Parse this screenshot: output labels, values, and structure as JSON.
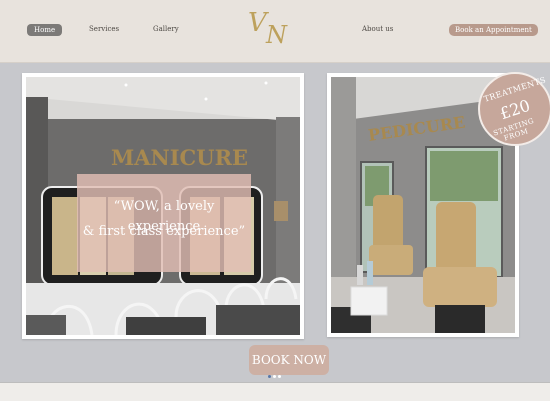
{
  "header": {
    "nav": {
      "home": "Home",
      "services": "Services",
      "gallery": "Gallery",
      "about": "About us",
      "book_appointment": "Book an Appointment"
    },
    "logo_text": {
      "v": "V",
      "n": "N"
    },
    "colors": {
      "background": "#e8e3dd",
      "logo": "#bda15c",
      "book_button": "#b89a8c"
    }
  },
  "gallery": {
    "manicure_photo": {
      "sign": "MANICURE",
      "quote_line1": "“WOW, a lovely experience",
      "quote_line2": "& first class experience”"
    },
    "pedicure_photo": {
      "sign": "PEDICURE"
    },
    "badge": {
      "line1": "TREATMENTS",
      "price": "£20",
      "line2": "STARTING FROM"
    }
  },
  "cta": {
    "book_now": "BOOK NOW"
  },
  "carousel": {
    "active_index": 1,
    "count": 3
  }
}
